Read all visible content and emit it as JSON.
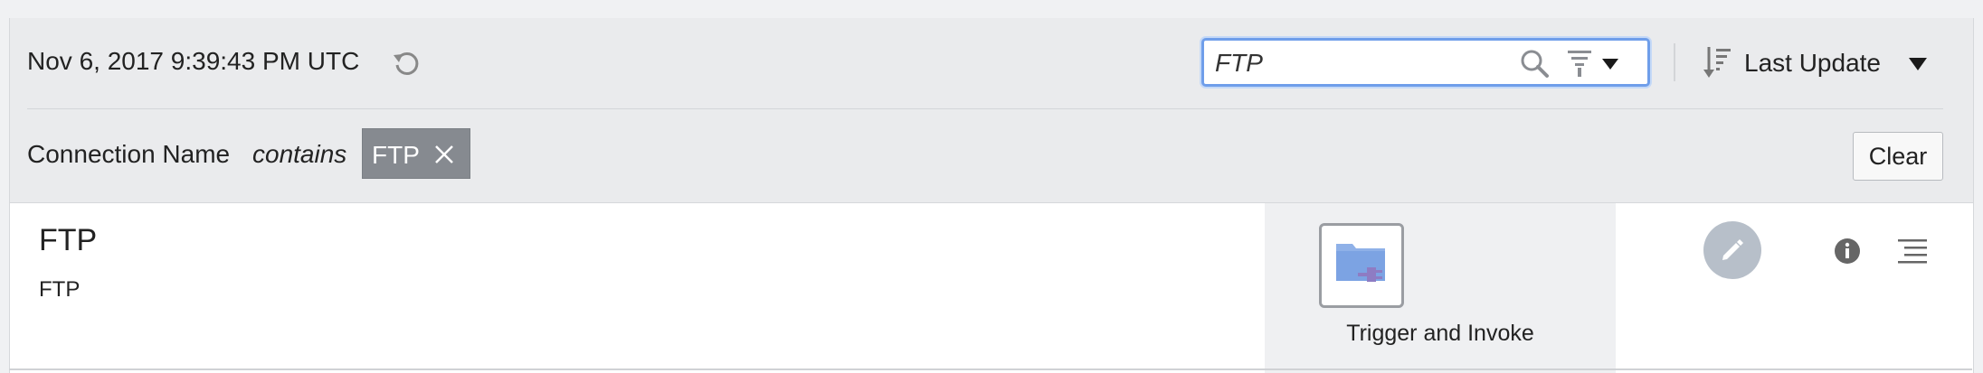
{
  "header": {
    "timestamp": "Nov 6, 2017 9:39:43 PM UTC",
    "refresh_icon": "refresh-icon"
  },
  "search": {
    "value": "FTP",
    "search_icon": "search-icon",
    "filter_icon": "filter-icon"
  },
  "sort": {
    "label": "Last Update",
    "icon": "sort-descending-icon"
  },
  "criteria": {
    "field": "Connection Name",
    "operator": "contains",
    "chip_value": "FTP"
  },
  "actions": {
    "clear_label": "Clear"
  },
  "connection": {
    "name": "FTP",
    "identifier": "FTP",
    "role_label": "Trigger and Invoke",
    "icon": "ftp-adapter-icon"
  },
  "colors": {
    "focus_ring": "#6f9eea",
    "chip_background": "#868a90",
    "edit_button": "#b7bfc9",
    "adapter_icon": "#7fa3e0"
  }
}
